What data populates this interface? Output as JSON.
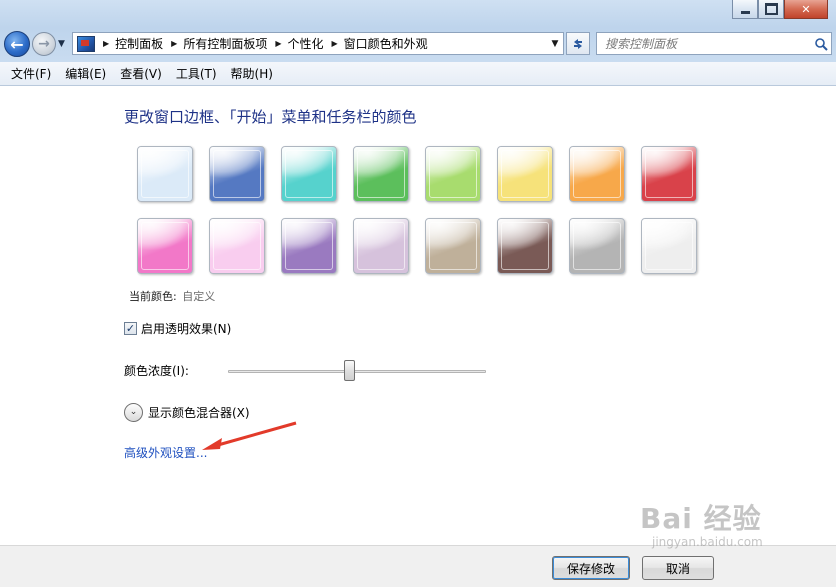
{
  "window": {
    "caption_buttons": [
      "minimize",
      "maximize",
      "close"
    ],
    "close_glyph": "✕"
  },
  "nav": {
    "back_glyph": "←",
    "forward_glyph": "→",
    "breadcrumbs": [
      "控制面板",
      "所有控制面板项",
      "个性化",
      "窗口颜色和外观"
    ],
    "search_placeholder": "搜索控制面板"
  },
  "menu": {
    "items": [
      "文件(F)",
      "编辑(E)",
      "查看(V)",
      "工具(T)",
      "帮助(H)"
    ]
  },
  "main": {
    "title": "更改窗口边框、「开始」菜单和任务栏的颜色",
    "swatches_row1": [
      {
        "name": "sky",
        "color": "#dbeaf8"
      },
      {
        "name": "twilight",
        "color": "#5579c2"
      },
      {
        "name": "sea",
        "color": "#56d2cd"
      },
      {
        "name": "leaf",
        "color": "#5cbf5c"
      },
      {
        "name": "lime",
        "color": "#a8dc6e"
      },
      {
        "name": "sun",
        "color": "#f6e27a"
      },
      {
        "name": "pumpkin",
        "color": "#f7a84a"
      },
      {
        "name": "ruby",
        "color": "#d9424a"
      }
    ],
    "swatches_row2": [
      {
        "name": "fuchsia",
        "color": "#f278c8"
      },
      {
        "name": "blush",
        "color": "#f9cdef"
      },
      {
        "name": "violet",
        "color": "#9a7ac0"
      },
      {
        "name": "lavender",
        "color": "#d6c2dc"
      },
      {
        "name": "taupe",
        "color": "#bfb09a"
      },
      {
        "name": "chocolate",
        "color": "#7a5a56"
      },
      {
        "name": "slate",
        "color": "#b4b4b4"
      },
      {
        "name": "frost",
        "color": "#eeeeee"
      }
    ],
    "current_color_label": "当前颜色:",
    "current_color_value": "自定义",
    "transparency_label": "启用透明效果(N)",
    "transparency_checked": true,
    "intensity_label": "颜色浓度(I):",
    "intensity_value": 0.47,
    "mixer_label": "显示颜色混合器(X)",
    "advanced_link": "高级外观设置..."
  },
  "footer": {
    "save_label": "保存修改",
    "cancel_label": "取消"
  },
  "watermark": {
    "logo": "Bai 经验",
    "url": "jingyan.baidu.com"
  },
  "colors": {
    "link": "#1e4fbf",
    "title": "#1e3287",
    "annotation": "#e23a2a"
  }
}
